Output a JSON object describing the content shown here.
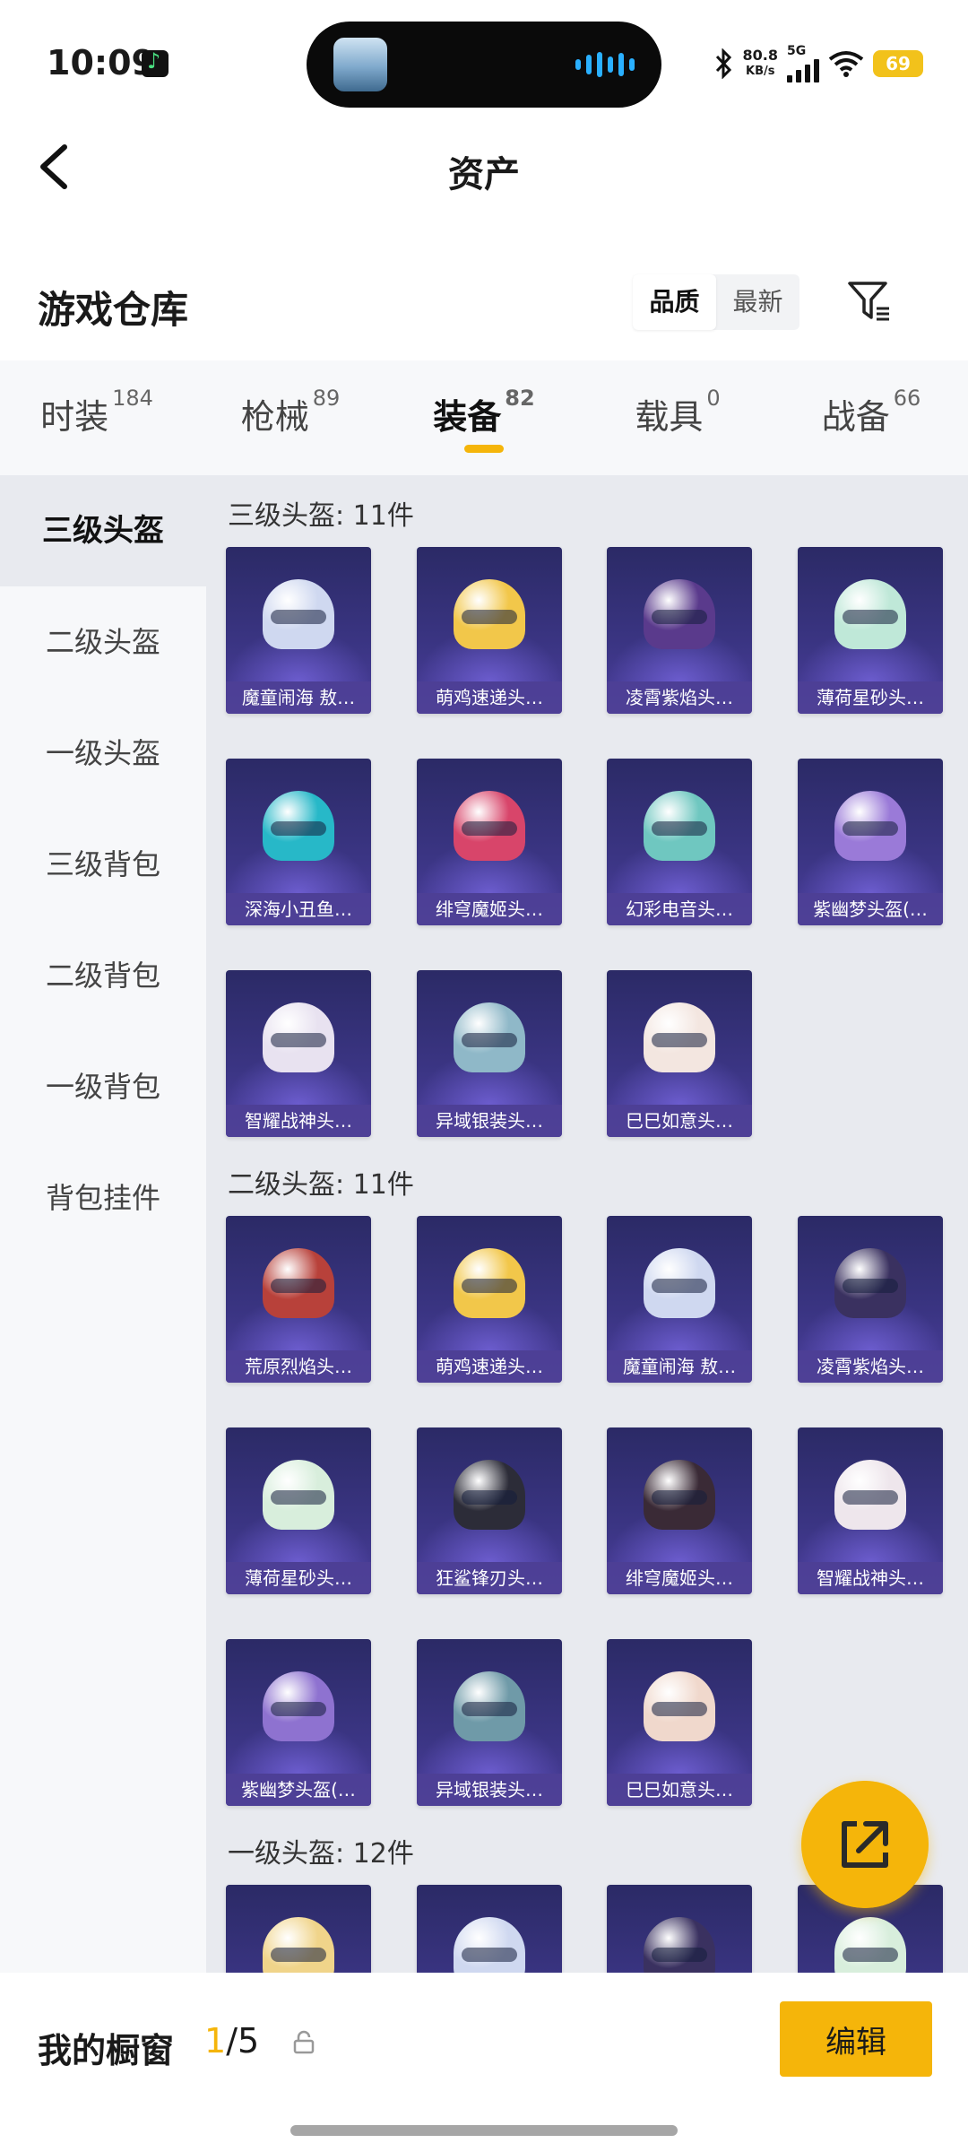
{
  "status_bar": {
    "time": "10:09",
    "net_speed": "80.8",
    "net_unit": "KB/s",
    "signal": "5G",
    "battery": "69"
  },
  "header": {
    "title": "资产"
  },
  "warehouse": {
    "title": "游戏仓库",
    "sort_options": [
      "品质",
      "最新"
    ]
  },
  "tabs": [
    {
      "label": "时装",
      "count": "184"
    },
    {
      "label": "枪械",
      "count": "89"
    },
    {
      "label": "装备",
      "count": "82"
    },
    {
      "label": "载具",
      "count": "0"
    },
    {
      "label": "战备",
      "count": "66"
    }
  ],
  "sidebar": {
    "items": [
      "三级头盔",
      "二级头盔",
      "一级头盔",
      "三级背包",
      "二级背包",
      "一级背包",
      "背包挂件"
    ]
  },
  "sections": [
    {
      "title": "三级头盔: 11件",
      "items": [
        {
          "name": "魔童闹海 敖…",
          "color": "#cfd8f0"
        },
        {
          "name": "萌鸡速递头…",
          "color": "#f2c74a"
        },
        {
          "name": "凌霄紫焰头…",
          "color": "#5a3a8c"
        },
        {
          "name": "薄荷星砂头…",
          "color": "#bfe8d8"
        },
        {
          "name": "深海小丑鱼…",
          "color": "#27b8c8"
        },
        {
          "name": "绯穹魔姬头…",
          "color": "#d8456a"
        },
        {
          "name": "幻彩电音头…",
          "color": "#6fc7c0"
        },
        {
          "name": "紫幽梦头盔(…",
          "color": "#9a7ad8"
        },
        {
          "name": "智耀战神头…",
          "color": "#e8e2f0"
        },
        {
          "name": "异域银装头…",
          "color": "#8fb8c8"
        },
        {
          "name": "巳巳如意头…",
          "color": "#f3e6e0"
        }
      ]
    },
    {
      "title": "二级头盔: 11件",
      "items": [
        {
          "name": "荒原烈焰头…",
          "color": "#b8413a"
        },
        {
          "name": "萌鸡速递头…",
          "color": "#f2c74a"
        },
        {
          "name": "魔童闹海 敖…",
          "color": "#cfd8f0"
        },
        {
          "name": "凌霄紫焰头…",
          "color": "#3a3160"
        },
        {
          "name": "薄荷星砂头…",
          "color": "#d8eedc"
        },
        {
          "name": "狂鲨锋刃头…",
          "color": "#2c2c38"
        },
        {
          "name": "绯穹魔姬头…",
          "color": "#3a2a36"
        },
        {
          "name": "智耀战神头…",
          "color": "#eee6ec"
        },
        {
          "name": "紫幽梦头盔(…",
          "color": "#8e72d0"
        },
        {
          "name": "异域银装头…",
          "color": "#6f9aa8"
        },
        {
          "name": "巳巳如意头…",
          "color": "#f0d8cc"
        }
      ]
    },
    {
      "title": "一级头盔: 12件",
      "items": [
        {
          "name": "",
          "color": "#f0d48a"
        },
        {
          "name": "",
          "color": "#cfd8f0"
        },
        {
          "name": "",
          "color": "#3a3160"
        },
        {
          "name": "",
          "color": "#d8eedc"
        }
      ]
    }
  ],
  "bottom": {
    "label": "我的橱窗",
    "current": "1",
    "total": "/5",
    "edit_label": "编辑"
  }
}
